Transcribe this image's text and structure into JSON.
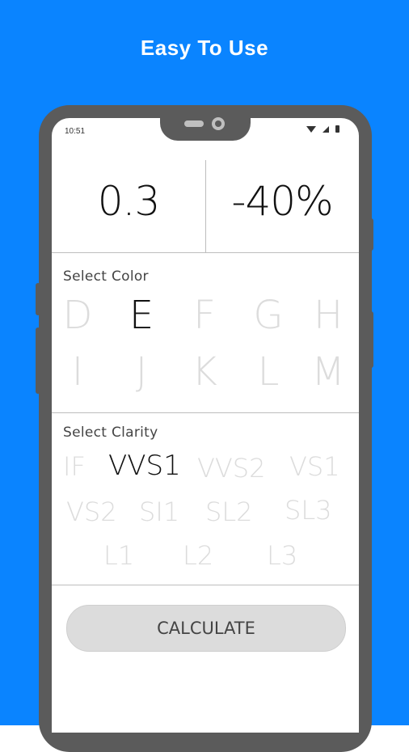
{
  "header": {
    "title": "Easy To Use"
  },
  "status_bar": {
    "time": "10:51"
  },
  "results": {
    "carat": "0.3",
    "price_change": "-40%"
  },
  "color_section": {
    "label": "Select Color",
    "grades": [
      "D",
      "E",
      "F",
      "G",
      "H",
      "I",
      "J",
      "K",
      "L",
      "M"
    ],
    "selected": "E"
  },
  "clarity_section": {
    "label": "Select Clarity",
    "grades": [
      "IF",
      "VVS1",
      "VVS2",
      "VS1",
      "VS2",
      "SI1",
      "SL2",
      "SL3",
      "L1",
      "L2",
      "L3"
    ],
    "selected": "VVS1"
  },
  "calculate_button": {
    "label": "CALCULATE"
  },
  "colors": {
    "background": "#0a84ff",
    "phone": "#5b5b5b",
    "selected": "#111111",
    "inactive": "#dcdcdc"
  }
}
